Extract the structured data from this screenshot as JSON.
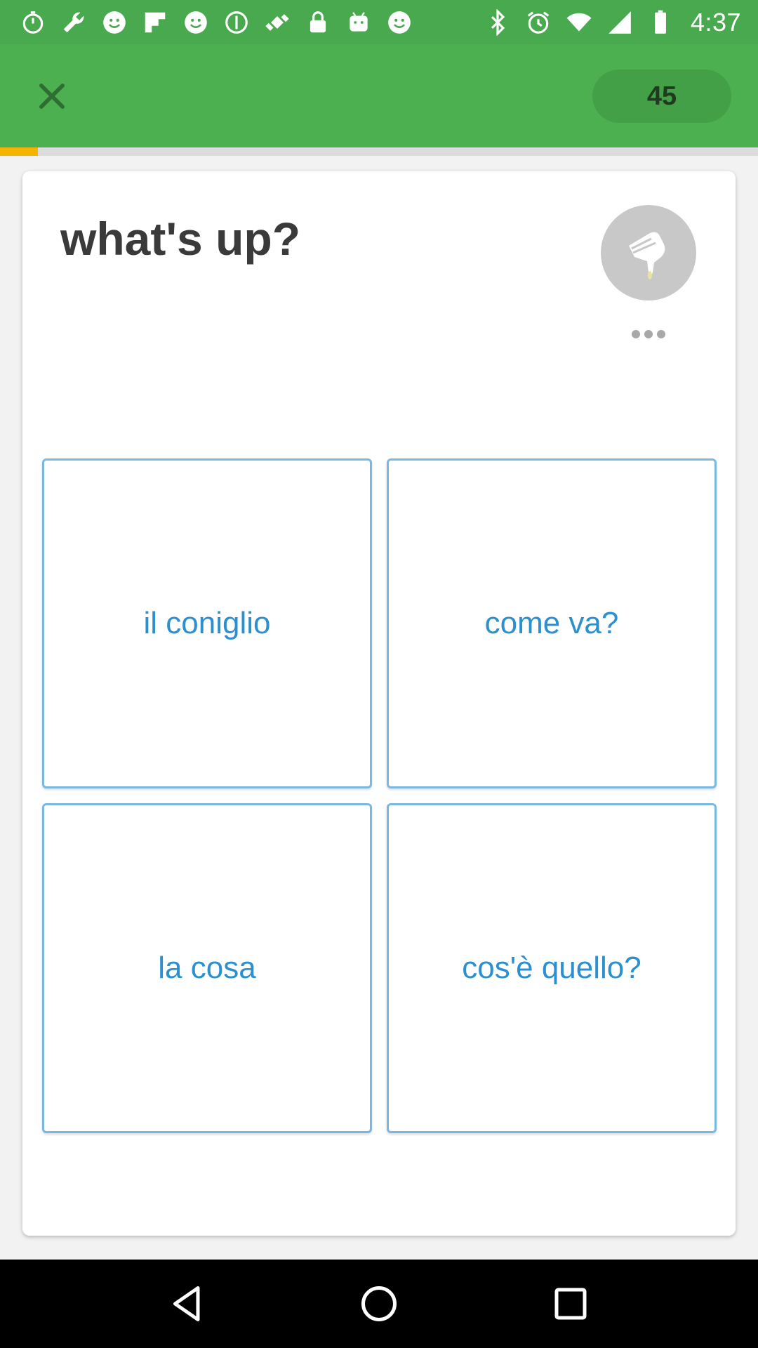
{
  "status_bar": {
    "time": "4:37",
    "left_icons": [
      "stopwatch-icon",
      "wrench-icon",
      "smiley-icon",
      "flipboard-icon",
      "smiley-icon",
      "sync-icon",
      "fake-gps-icon",
      "lock-icon",
      "android-icon",
      "smiley-icon"
    ],
    "right_icons": [
      "bluetooth-icon",
      "alarm-icon",
      "wifi-icon",
      "signal-icon",
      "battery-icon"
    ],
    "background_color": "#48a94e"
  },
  "header": {
    "close_icon": "close-icon",
    "score": "45",
    "progress_fraction": 0.05,
    "accent_color": "#4caf50",
    "progress_color": "#f5b400"
  },
  "card": {
    "prompt": "what's up?",
    "audio_icon": "speaker-hand-icon",
    "more_icon": "more-dots-icon"
  },
  "options": [
    {
      "label": "il coniglio"
    },
    {
      "label": "come va?"
    },
    {
      "label": "la cosa"
    },
    {
      "label": "cos'è quello?"
    }
  ],
  "nav_bar": {
    "buttons": [
      "back-icon",
      "home-icon",
      "recents-icon"
    ]
  }
}
